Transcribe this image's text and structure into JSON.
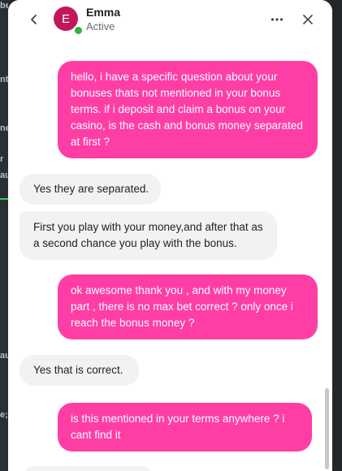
{
  "header": {
    "avatar_initial": "E",
    "agent_name": "Emma",
    "agent_status": "Active",
    "icons": [
      "chevron-left-icon",
      "more-horizontal-icon",
      "close-icon"
    ]
  },
  "background_fragments": [
    "ber",
    "nt",
    "ne",
    "r",
    "au",
    "au",
    "e;"
  ],
  "messages": [
    {
      "sender": "user",
      "text": "hello, i have a specific question about your bonuses thats not mentioned in your bonus terms. if i deposit and claim a bonus on your casino, is the cash and bonus money separated at first ?"
    },
    {
      "sender": "agent",
      "text": "Yes they are separated."
    },
    {
      "sender": "agent",
      "text": "First you play with your money,and after that as a second chance you play with the bonus."
    },
    {
      "sender": "user",
      "text": "ok awesome thank you , and with my money part , there is no max bet correct ? only once i reach the bonus money ?"
    },
    {
      "sender": "agent",
      "text": "Yes that is correct."
    },
    {
      "sender": "user",
      "text": "is this mentioned in your terms anywhere ? i cant find it"
    }
  ],
  "colors": {
    "user_bubble": "#ff3ea5",
    "agent_bubble": "#f2f2f2",
    "avatar": "#c2185b",
    "online": "#2fb344"
  }
}
